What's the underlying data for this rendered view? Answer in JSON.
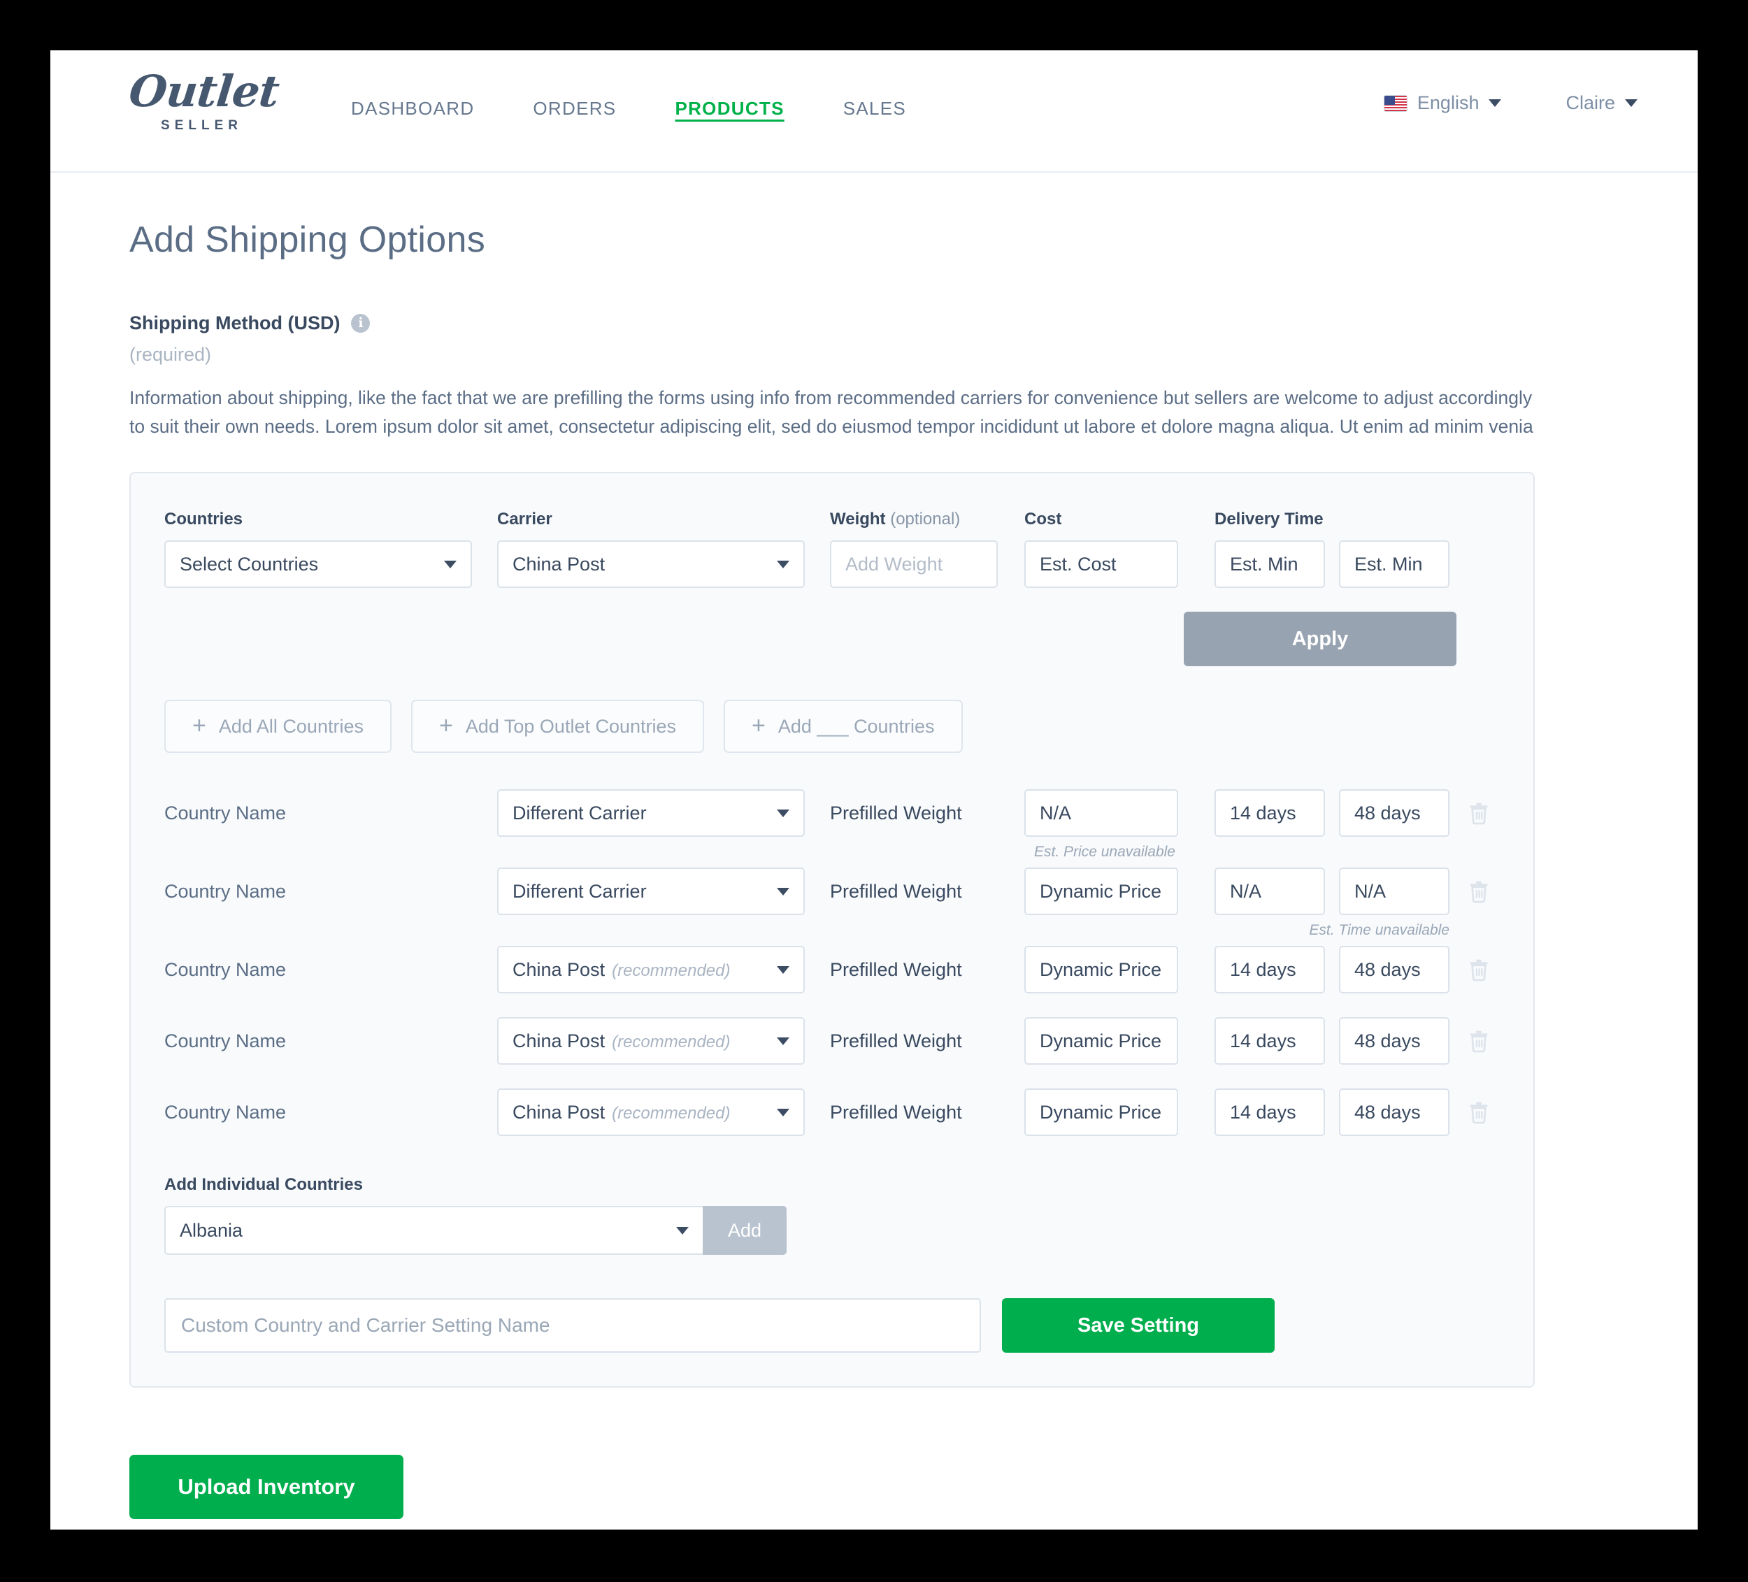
{
  "brand": {
    "name": "Outlet",
    "subtitle": "SELLER"
  },
  "nav": {
    "items": [
      {
        "label": "DASHBOARD",
        "active": false
      },
      {
        "label": "ORDERS",
        "active": false
      },
      {
        "label": "PRODUCTS",
        "active": true
      },
      {
        "label": "SALES",
        "active": false
      }
    ],
    "active_color": "#00b14a"
  },
  "header_right": {
    "language": "English",
    "language_flag": "us-flag-icon",
    "user": "Claire"
  },
  "page": {
    "title": "Add Shipping Options",
    "section_title": "Shipping Method (USD)",
    "info_glyph": "i",
    "required_note": "(required)",
    "blurb": "Information about shipping, like the fact that we are prefilling the forms using info from recommended carriers for convenience but sellers are welcome to adjust accordingly to suit their own needs. Lorem ipsum dolor sit amet, consectetur adipiscing elit, sed do eiusmod tempor incididunt ut labore et dolore magna aliqua. Ut enim ad minim venia"
  },
  "form": {
    "labels": {
      "countries": "Countries",
      "carrier": "Carrier",
      "weight": "Weight",
      "weight_suffix": "(optional)",
      "cost": "Cost",
      "delivery_time": "Delivery Time"
    },
    "values": {
      "countries": "Select Countries",
      "carrier": "China Post",
      "weight_placeholder": "Add Weight",
      "cost": "Est. Cost",
      "time_min": "Est. Min",
      "time_max": "Est. Min"
    },
    "apply_label": "Apply"
  },
  "quick_add": {
    "buttons": [
      {
        "label": "Add All Countries"
      },
      {
        "label": "Add Top Outlet Countries"
      },
      {
        "label": "Add ___ Countries"
      }
    ],
    "plus_glyph": "+"
  },
  "table": {
    "rows": [
      {
        "country": "Country Name",
        "carrier": "Different Carrier",
        "carrier_tag": "",
        "weight": "Prefilled Weight",
        "cost": "N/A",
        "time_min": "14 days",
        "time_max": "48 days",
        "note": "Est. Price unavailable",
        "note_position": "cost"
      },
      {
        "country": "Country Name",
        "carrier": "Different Carrier",
        "carrier_tag": "",
        "weight": "Prefilled Weight",
        "cost": "Dynamic Price",
        "time_min": "N/A",
        "time_max": "N/A",
        "note": "Est. Time unavailable",
        "note_position": "time"
      },
      {
        "country": "Country Name",
        "carrier": "China Post",
        "carrier_tag": "(recommended)",
        "weight": "Prefilled Weight",
        "cost": "Dynamic Price",
        "time_min": "14 days",
        "time_max": "48 days",
        "note": "",
        "note_position": ""
      },
      {
        "country": "Country Name",
        "carrier": "China Post",
        "carrier_tag": "(recommended)",
        "weight": "Prefilled Weight",
        "cost": "Dynamic Price",
        "time_min": "14 days",
        "time_max": "48 days",
        "note": "",
        "note_position": ""
      },
      {
        "country": "Country Name",
        "carrier": "China Post",
        "carrier_tag": "(recommended)",
        "weight": "Prefilled Weight",
        "cost": "Dynamic Price",
        "time_min": "14 days",
        "time_max": "48 days",
        "note": "",
        "note_position": ""
      }
    ]
  },
  "individual": {
    "label": "Add Individual Countries",
    "selected": "Albania",
    "add_label": "Add"
  },
  "save": {
    "custom_name_placeholder": "Custom Country and Carrier Setting Name",
    "custom_name_value": "",
    "save_label": "Save Setting"
  },
  "footer": {
    "upload_label": "Upload Inventory"
  },
  "colors": {
    "green": "#00ae4d",
    "slate": "#39495f",
    "muted": "#9aa7b6",
    "apply_gray": "#97a3b1"
  }
}
